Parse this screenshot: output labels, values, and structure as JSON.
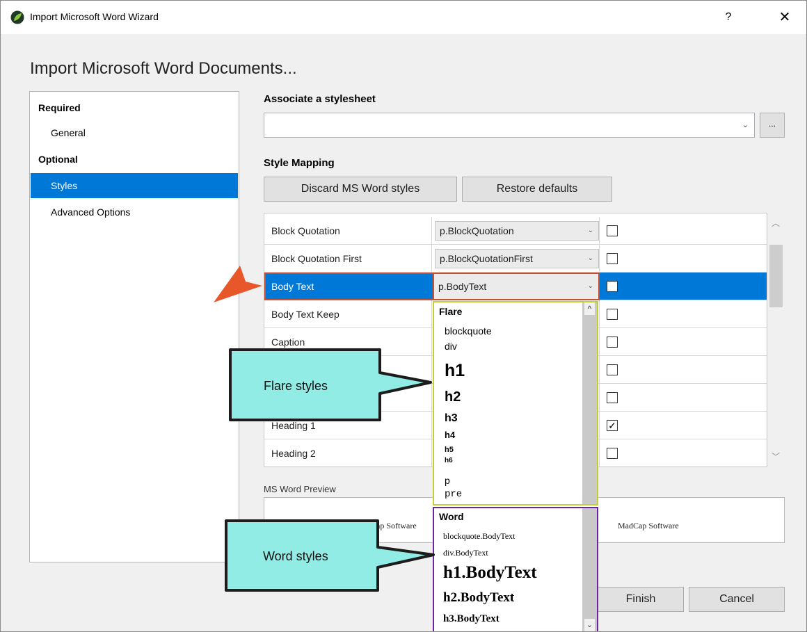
{
  "window": {
    "title": "Import Microsoft Word Wizard",
    "help": "?",
    "close": "✕"
  },
  "page_title": "Import Microsoft Word Documents...",
  "nav": {
    "required": "Required",
    "general": "General",
    "optional": "Optional",
    "styles": "Styles",
    "advanced": "Advanced Options"
  },
  "stylesheet": {
    "label": "Associate a stylesheet",
    "value": "",
    "browse": "..."
  },
  "style_mapping": {
    "label": "Style Mapping",
    "discard": "Discard MS Word styles",
    "restore": "Restore defaults",
    "rows": [
      {
        "name": "Block Quotation",
        "value": "p.BlockQuotation",
        "checked": false
      },
      {
        "name": "Block Quotation First",
        "value": "p.BlockQuotationFirst",
        "checked": false
      },
      {
        "name": "Body Text",
        "value": "p.BodyText",
        "checked": false
      },
      {
        "name": "Body Text Keep",
        "value": "",
        "checked": false
      },
      {
        "name": "Caption",
        "value": "",
        "checked": false
      },
      {
        "name": "",
        "value": "",
        "checked": false
      },
      {
        "name": "",
        "value": "",
        "checked": false
      },
      {
        "name": "Heading 1",
        "value": "",
        "checked": true
      },
      {
        "name": "Heading 2",
        "value": "",
        "checked": false
      }
    ]
  },
  "preview": {
    "label": "MS Word Preview",
    "left_text": "ap Software",
    "right_text": "MadCap Software"
  },
  "flare_dropdown": {
    "header": "Flare",
    "items": [
      "blockquote",
      "div",
      "h1",
      "h2",
      "h3",
      "h4",
      "h5",
      "h6",
      "p",
      "pre"
    ]
  },
  "word_dropdown": {
    "header": "Word",
    "items": [
      "blockquote.BodyText",
      "div.BodyText",
      "h1.BodyText",
      "h2.BodyText",
      "h3.BodyText"
    ]
  },
  "footer": {
    "finish": "Finish",
    "cancel": "Cancel"
  },
  "callouts": {
    "flare": "Flare styles",
    "word": "Word styles"
  },
  "colors": {
    "selection": "#0078d7",
    "flare_border": "#c2cf37",
    "word_border": "#6a24a4",
    "callout_fill": "#92ece6",
    "arrow": "#e8572a"
  }
}
